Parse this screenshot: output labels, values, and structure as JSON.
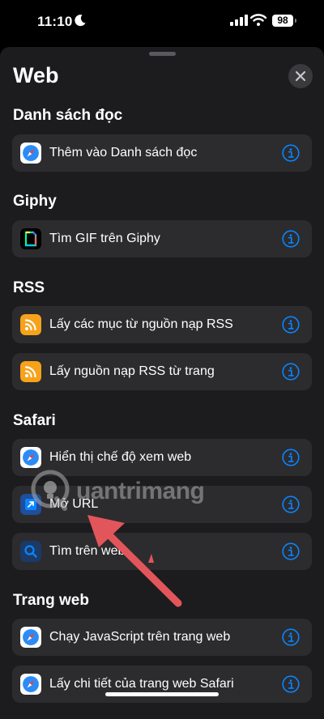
{
  "status_bar": {
    "time": "11:10",
    "battery": "98"
  },
  "sheet": {
    "title": "Web"
  },
  "sections": [
    {
      "title": "Danh sách đọc",
      "items": [
        {
          "label": "Thêm vào Danh sách đọc",
          "icon": "safari-icon"
        }
      ]
    },
    {
      "title": "Giphy",
      "items": [
        {
          "label": "Tìm GIF trên Giphy",
          "icon": "giphy-icon"
        }
      ]
    },
    {
      "title": "RSS",
      "items": [
        {
          "label": "Lấy các mục từ nguồn nạp RSS",
          "icon": "rss-icon"
        },
        {
          "label": "Lấy nguồn nạp RSS từ trang",
          "icon": "rss-icon"
        }
      ]
    },
    {
      "title": "Safari",
      "items": [
        {
          "label": "Hiển thị chế độ xem web",
          "icon": "safari-icon"
        },
        {
          "label": "Mở URL",
          "icon": "open-url-icon"
        },
        {
          "label": "Tìm trên web",
          "icon": "search-icon"
        }
      ]
    },
    {
      "title": "Trang web",
      "items": [
        {
          "label": "Chạy JavaScript trên trang web",
          "icon": "safari-icon"
        },
        {
          "label": "Lấy chi tiết của trang web Safari",
          "icon": "safari-icon"
        }
      ]
    }
  ],
  "watermark": {
    "text": "uantrimang"
  },
  "colors": {
    "accent": "#0a84ff",
    "rss": "#f7a21b",
    "sheet": "#1c1c1e",
    "row": "#2c2c2e"
  }
}
